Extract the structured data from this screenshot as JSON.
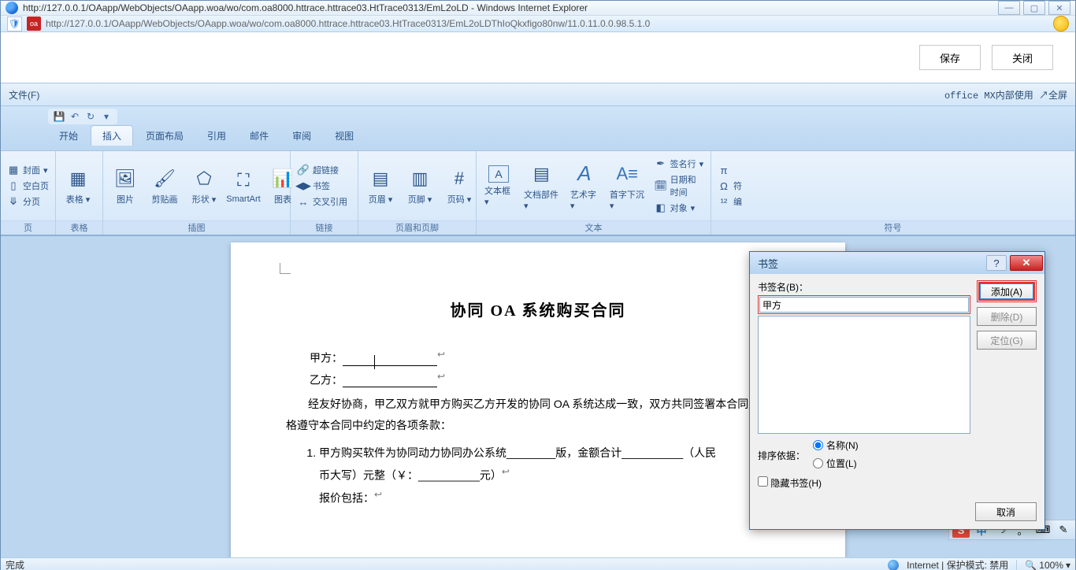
{
  "window": {
    "title": "http://127.0.0.1/OAapp/WebObjects/OAapp.woa/wo/com.oa8000.httrace.httrace03.HtTrace0313/EmL2oLD - Windows Internet Explorer",
    "url": "http://127.0.0.1/OAapp/WebObjects/OAapp.woa/wo/com.oa8000.httrace.httrace03.HtTrace0313/EmL2oLDThIoQkxfigo80nw/11.0.11.0.0.98.5.1.0",
    "min": "—",
    "max": "▢",
    "close": "✕"
  },
  "topbar": {
    "save": "保存",
    "close": "关闭"
  },
  "menuband": {
    "file": "文件(F)",
    "right": "office MX内部使用 ↗全屏"
  },
  "word": {
    "tabs": [
      "开始",
      "插入",
      "页面布局",
      "引用",
      "邮件",
      "审阅",
      "视图"
    ],
    "active_tab_index": 1,
    "groups": {
      "page": {
        "label": "页",
        "cover": "封面",
        "blank": "空白页",
        "break": "分页"
      },
      "table": {
        "label": "表格",
        "table": "表格"
      },
      "illus": {
        "label": "插图",
        "pic": "图片",
        "clip": "剪贴画",
        "shape": "形状",
        "smart": "SmartArt",
        "chart": "图表"
      },
      "links": {
        "label": "链接",
        "hyper": "超链接",
        "bookmark": "书签",
        "xref": "交叉引用"
      },
      "hf": {
        "label": "页眉和页脚",
        "header": "页眉",
        "footer": "页脚",
        "pno": "页码"
      },
      "text": {
        "label": "文本",
        "tbox": "文本框",
        "parts": "文档部件",
        "wart": "艺术字",
        "drop": "首字下沉",
        "sigline": "签名行",
        "datetime": "日期和时间",
        "object": "对象"
      },
      "sym": {
        "label": "符号",
        "eq": "π",
        "sym": "符",
        "no": "编"
      }
    }
  },
  "doc": {
    "title": "协同 OA 系统购买合同",
    "field_a": "甲方：",
    "field_b": "乙方：",
    "para1": "经友好协商，甲乙双方就甲方购买乙方开发的协同 OA 系统达成一致，双方共同签署本合同，并严格遵守本合同中约定的各项条款：",
    "li1a": "甲方购买软件为协同动力协同办公系统________版，金额合计__________（人民",
    "li1b": "币大写）元整（￥：__________元）",
    "li1c": "报价包括："
  },
  "dialog": {
    "title": "书签",
    "name_label": "书签名(B)：",
    "name_value": "甲方",
    "add": "添加(A)",
    "del": "删除(D)",
    "goto": "定位(G)",
    "sort_label": "排序依据：",
    "sort_name": "名称(N)",
    "sort_loc": "位置(L)",
    "hide": "隐藏书签(H)",
    "cancel": "取消"
  },
  "status": {
    "done": "完成",
    "zone": "Internet | 保护模式: 禁用",
    "zoom": "100%"
  },
  "ime": {
    "s": "S",
    "cn": "中",
    "moon": "☽",
    "period": "。",
    "kb": "⌨",
    "gear": "✎"
  }
}
